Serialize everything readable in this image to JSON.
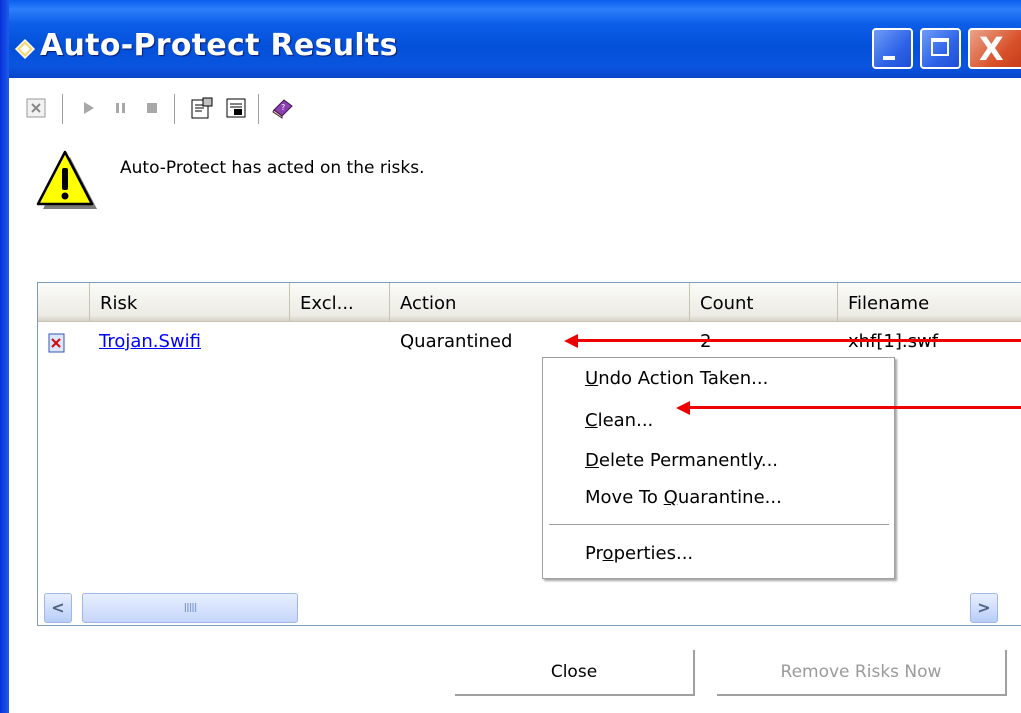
{
  "window": {
    "title": "Auto-Protect Results",
    "icons": {
      "app": "shield-diamond-icon",
      "minimize": "minimize-icon",
      "maximize": "maximize-icon",
      "close": "close-icon",
      "close_glyph": "X"
    }
  },
  "toolbar": {
    "items": [
      "close-x-icon",
      "play-icon",
      "pause-icon",
      "stop-icon",
      "properties-icon",
      "details-icon",
      "help-book-icon"
    ]
  },
  "status": {
    "icon": "warning-icon",
    "message": "Auto-Protect has acted on the risks."
  },
  "table": {
    "columns": [
      "Risk",
      "Excl...",
      "Action",
      "Count",
      "Filename"
    ],
    "rows": [
      {
        "risk": "Trojan.Swifi",
        "exclusion": "",
        "action": "Quarantined",
        "count": "2",
        "filename": "xhf[1].swf",
        "icon": "risk-file-icon"
      }
    ],
    "scrollbar": {
      "left": "<",
      "right": ">",
      "thumb_grip": "IIIII"
    }
  },
  "context_menu": {
    "items": [
      {
        "pre": "",
        "key": "U",
        "post": "ndo Action Taken..."
      },
      {
        "pre": "",
        "key": "C",
        "post": "lean..."
      },
      {
        "pre": "",
        "key": "D",
        "post": "elete Permanently..."
      },
      {
        "pre": "Move To ",
        "key": "Q",
        "post": "uarantine..."
      },
      {
        "pre": "Pr",
        "key": "o",
        "post": "perties..."
      }
    ]
  },
  "annotations": {
    "arrow_color": "#ee0000"
  },
  "buttons": {
    "close": "Close",
    "remove": "Remove Risks Now"
  },
  "colors": {
    "titlebar": "#0a5eed",
    "link": "#0000ff",
    "disabled_text": "#9a9a9a"
  }
}
